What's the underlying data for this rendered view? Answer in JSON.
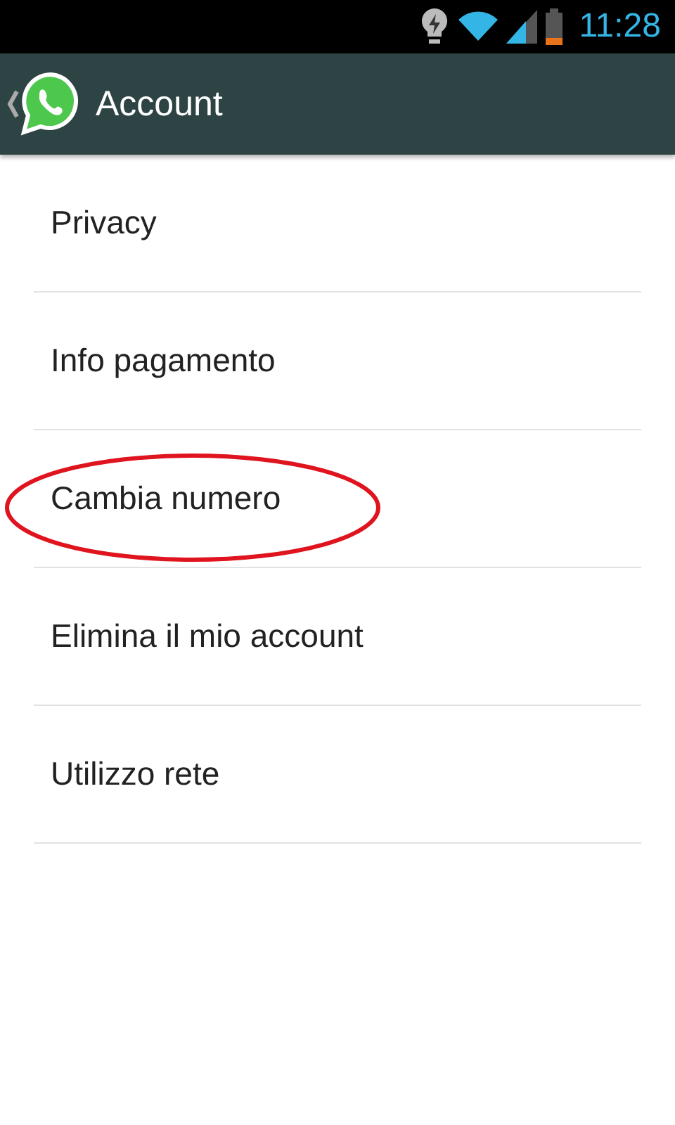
{
  "status_bar": {
    "time": "11:28"
  },
  "action_bar": {
    "title": "Account"
  },
  "items": [
    {
      "label": "Privacy",
      "circled": false
    },
    {
      "label": "Info pagamento",
      "circled": false
    },
    {
      "label": "Cambia numero",
      "circled": true
    },
    {
      "label": "Elimina il mio account",
      "circled": false
    },
    {
      "label": "Utilizzo rete",
      "circled": false
    }
  ]
}
